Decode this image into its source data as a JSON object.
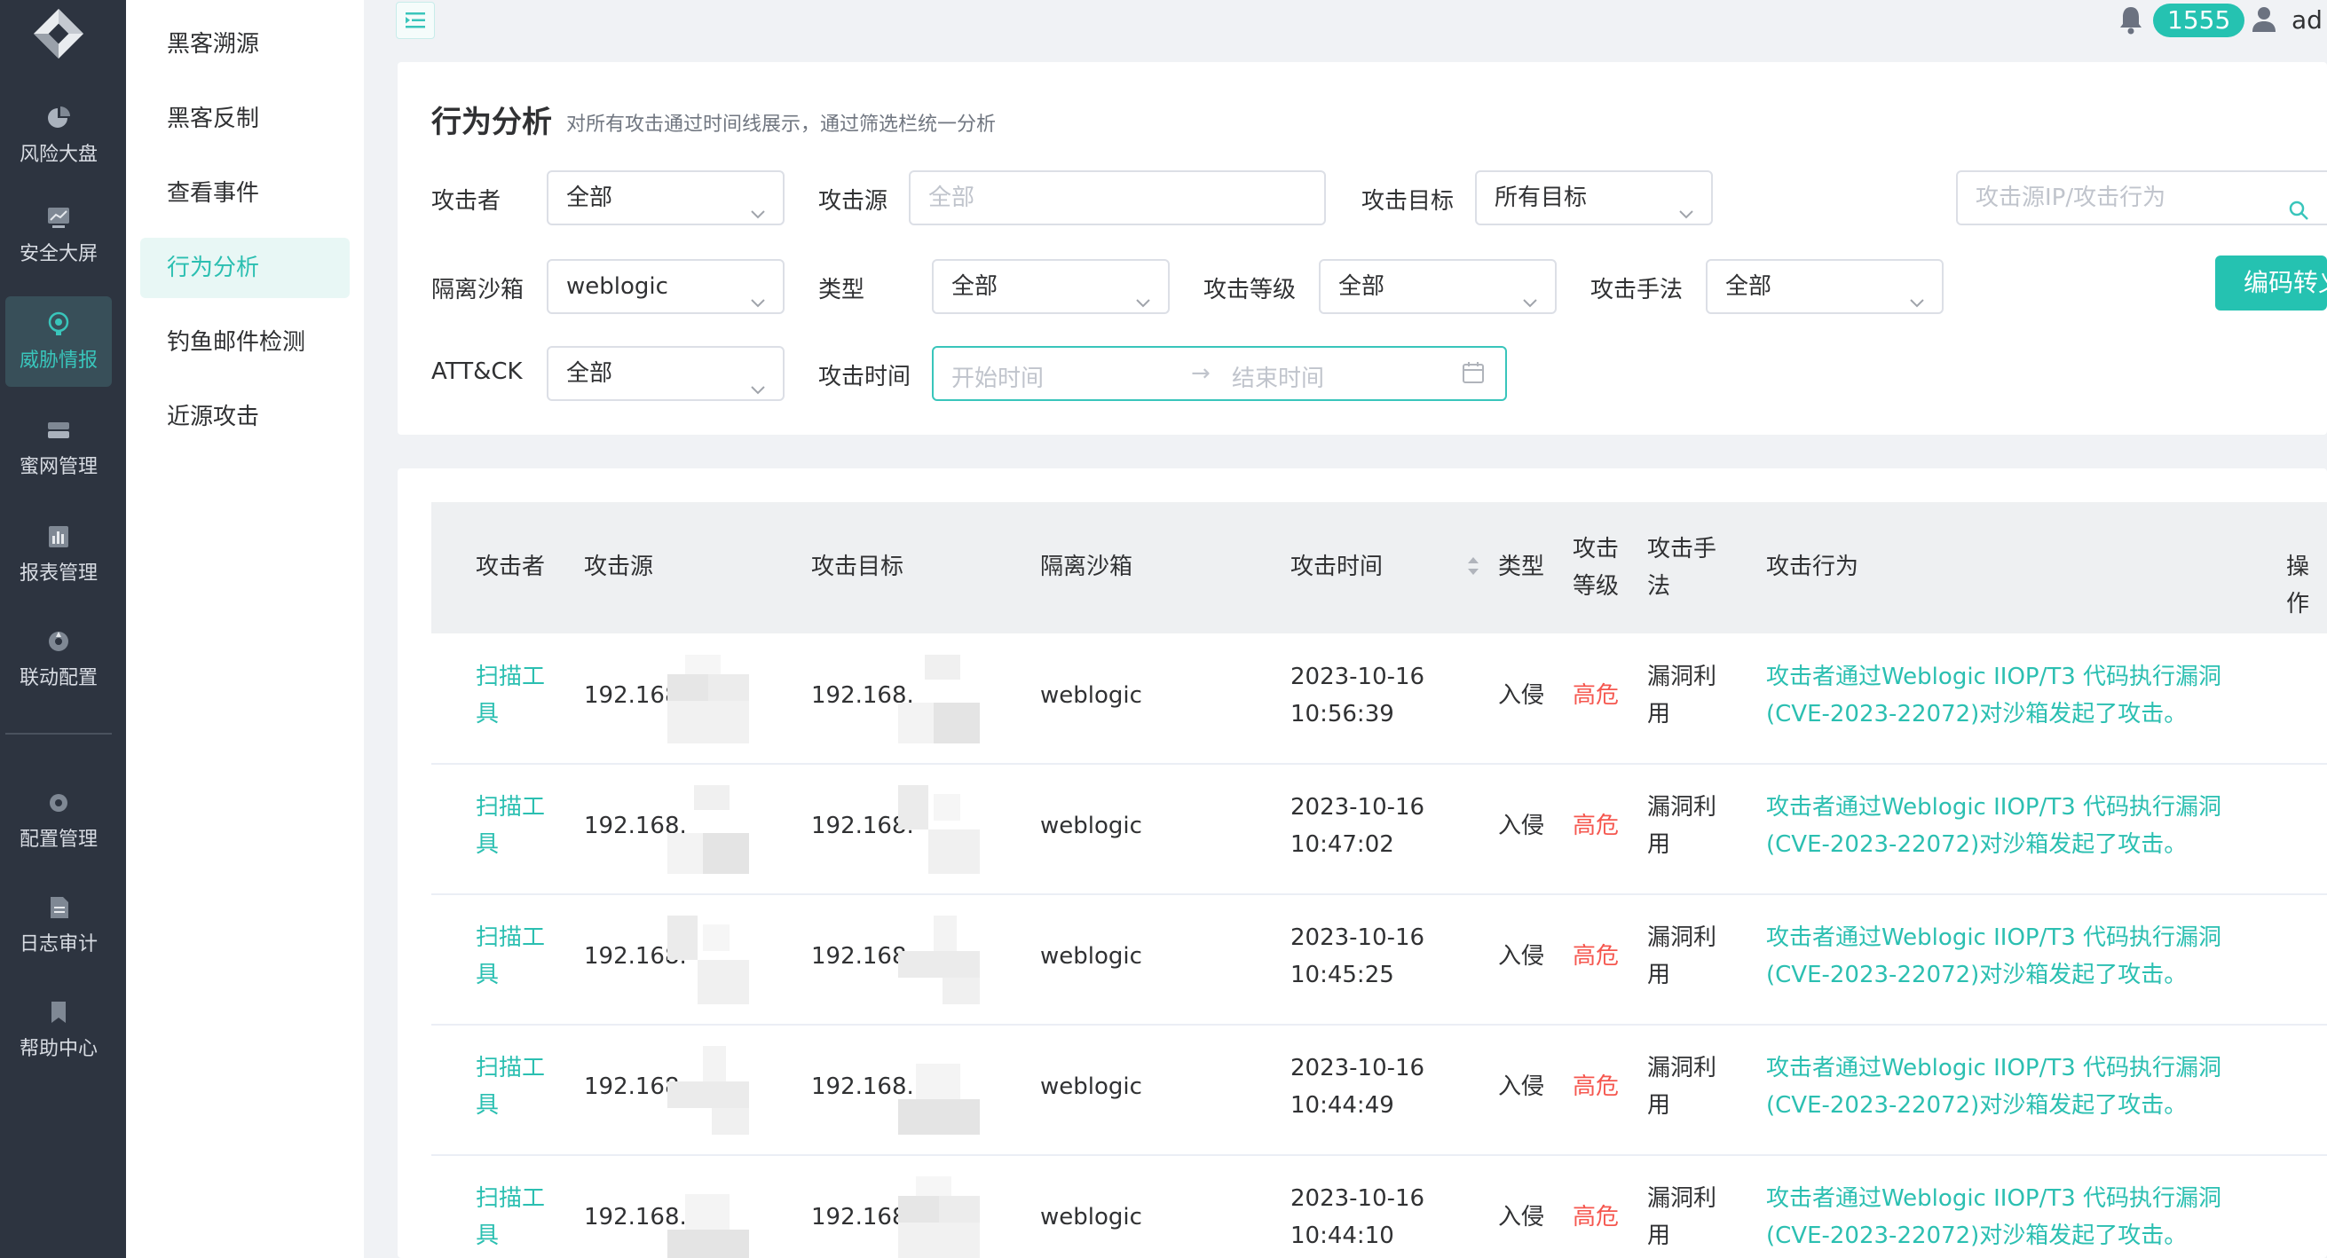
{
  "rail": {
    "items": [
      {
        "label": "风险大盘",
        "icon": "pie-chart-icon"
      },
      {
        "label": "安全大屏",
        "icon": "line-chart-icon"
      },
      {
        "label": "威胁情报",
        "icon": "threat-intel-icon",
        "active": true
      },
      {
        "label": "蜜网管理",
        "icon": "honeynet-icon"
      },
      {
        "label": "报表管理",
        "icon": "report-icon"
      },
      {
        "label": "联动配置",
        "icon": "linkage-icon"
      },
      {
        "label": "配置管理",
        "icon": "config-icon"
      },
      {
        "label": "日志审计",
        "icon": "log-icon"
      },
      {
        "label": "帮助中心",
        "icon": "help-icon"
      }
    ]
  },
  "submenu": {
    "items": [
      {
        "label": "黑客溯源"
      },
      {
        "label": "黑客反制"
      },
      {
        "label": "查看事件"
      },
      {
        "label": "行为分析",
        "active": true
      },
      {
        "label": "钓鱼邮件检测"
      },
      {
        "label": "近源攻击"
      }
    ]
  },
  "header": {
    "notification_count": "1555",
    "user": "ad"
  },
  "filter": {
    "title": "行为分析",
    "desc": "对所有攻击通过时间线展示，通过筛选栏统一分析",
    "attacker_label": "攻击者",
    "attacker_value": "全部",
    "source_label": "攻击源",
    "source_placeholder": "全部",
    "target_label": "攻击目标",
    "target_value": "所有目标",
    "search_placeholder": "攻击源IP/攻击行为",
    "sandbox_label": "隔离沙箱",
    "sandbox_value": "weblogic",
    "type_label": "类型",
    "type_value": "全部",
    "level_label": "攻击等级",
    "level_value": "全部",
    "method_label": "攻击手法",
    "method_value": "全部",
    "encode_button": "编码转义",
    "attck_label": "ATT&CK",
    "attck_value": "全部",
    "time_label": "攻击时间",
    "start_placeholder": "开始时间",
    "end_placeholder": "结束时间",
    "range_arrow": "→"
  },
  "table": {
    "headers": {
      "attacker": "攻击者",
      "source": "攻击源",
      "target": "攻击目标",
      "sandbox": "隔离沙箱",
      "time": "攻击时间",
      "type": "类型",
      "level_1": "攻击",
      "level_2": "等级",
      "method_1": "攻击手",
      "method_2": "法",
      "behavior": "攻击行为",
      "action": "操作"
    },
    "rows": [
      {
        "attacker_1": "扫描工",
        "attacker_2": "具",
        "source": "192.168.",
        "target": "192.168.",
        "sandbox": "weblogic",
        "date": "2023-10-16",
        "time": "10:56:39",
        "type": "入侵",
        "level": "高危",
        "method_1": "漏洞利",
        "method_2": "用",
        "behavior_1": "攻击者通过Weblogic IIOP/T3 代码执行漏洞",
        "behavior_2": "(CVE-2023-22072)对沙箱发起了攻击。"
      },
      {
        "attacker_1": "扫描工",
        "attacker_2": "具",
        "source": "192.168.",
        "target": "192.168.",
        "sandbox": "weblogic",
        "date": "2023-10-16",
        "time": "10:47:02",
        "type": "入侵",
        "level": "高危",
        "method_1": "漏洞利",
        "method_2": "用",
        "behavior_1": "攻击者通过Weblogic IIOP/T3 代码执行漏洞",
        "behavior_2": "(CVE-2023-22072)对沙箱发起了攻击。"
      },
      {
        "attacker_1": "扫描工",
        "attacker_2": "具",
        "source": "192.168.",
        "target": "192.168.",
        "sandbox": "weblogic",
        "date": "2023-10-16",
        "time": "10:45:25",
        "type": "入侵",
        "level": "高危",
        "method_1": "漏洞利",
        "method_2": "用",
        "behavior_1": "攻击者通过Weblogic IIOP/T3 代码执行漏洞",
        "behavior_2": "(CVE-2023-22072)对沙箱发起了攻击。"
      },
      {
        "attacker_1": "扫描工",
        "attacker_2": "具",
        "source": "192.168.",
        "target": "192.168.",
        "sandbox": "weblogic",
        "date": "2023-10-16",
        "time": "10:44:49",
        "type": "入侵",
        "level": "高危",
        "method_1": "漏洞利",
        "method_2": "用",
        "behavior_1": "攻击者通过Weblogic IIOP/T3 代码执行漏洞",
        "behavior_2": "(CVE-2023-22072)对沙箱发起了攻击。"
      },
      {
        "attacker_1": "扫描工",
        "attacker_2": "具",
        "source": "192.168.",
        "target": "192.168.",
        "sandbox": "weblogic",
        "date": "2023-10-16",
        "time": "10:44:10",
        "type": "入侵",
        "level": "高危",
        "method_1": "漏洞利",
        "method_2": "用",
        "behavior_1": "攻击者通过Weblogic IIOP/T3 代码执行漏洞",
        "behavior_2": "(CVE-2023-22072)对沙箱发起了攻击。"
      }
    ]
  },
  "colors": {
    "accent": "#25c2b1",
    "danger": "#f5574f",
    "rail_bg": "#2d3440"
  }
}
